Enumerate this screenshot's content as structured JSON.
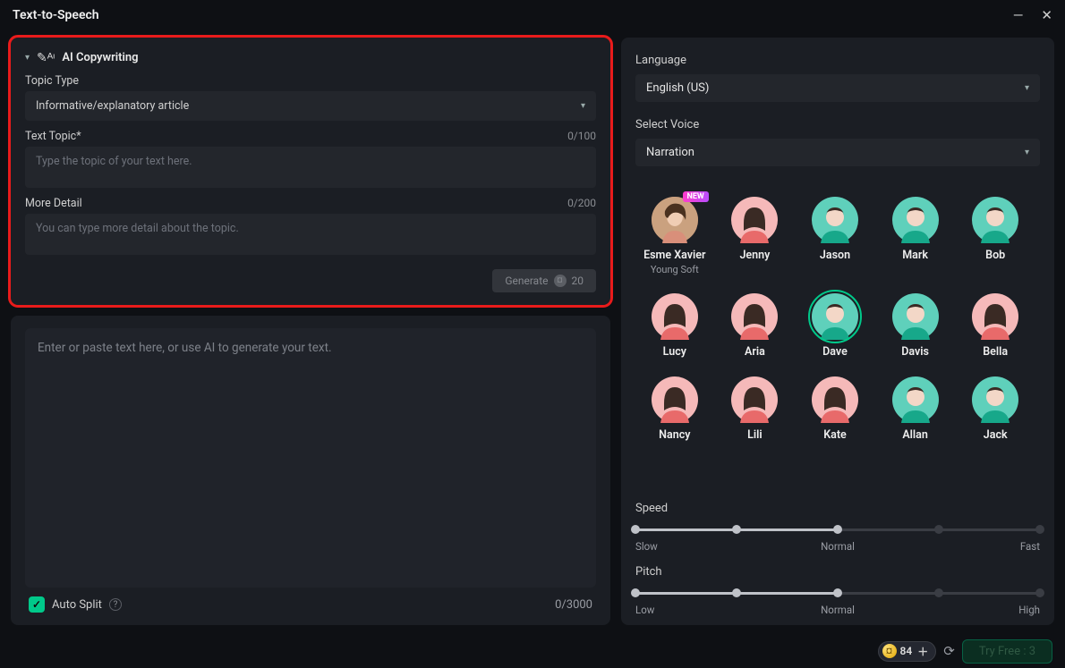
{
  "window": {
    "title": "Text-to-Speech"
  },
  "ai": {
    "heading": "AI Copywriting",
    "topic_type_label": "Topic Type",
    "topic_type_value": "Informative/explanatory article",
    "text_topic_label": "Text Topic*",
    "text_topic_counter": "0/100",
    "text_topic_placeholder": "Type the topic of your text here.",
    "more_detail_label": "More Detail",
    "more_detail_counter": "0/200",
    "more_detail_placeholder": "You can type more detail about the topic.",
    "generate_label": "Generate",
    "generate_cost": "20"
  },
  "editor": {
    "placeholder": "Enter or paste text here, or use AI to generate your text.",
    "autosplit_label": "Auto Split",
    "counter": "0/3000"
  },
  "side": {
    "language_label": "Language",
    "language_value": "English (US)",
    "voice_label": "Select Voice",
    "voice_value": "Narration"
  },
  "voices": [
    {
      "name": "Esme Xavier",
      "sub": "Young Soft",
      "photo": true,
      "badge": "NEW"
    },
    {
      "name": "Jenny",
      "g": "f",
      "col": "pink"
    },
    {
      "name": "Jason",
      "g": "m",
      "col": "teal"
    },
    {
      "name": "Mark",
      "g": "m",
      "col": "teal"
    },
    {
      "name": "Bob",
      "g": "m",
      "col": "teal"
    },
    {
      "name": "Lucy",
      "g": "f",
      "col": "pink"
    },
    {
      "name": "Aria",
      "g": "f",
      "col": "pink"
    },
    {
      "name": "Dave",
      "g": "m",
      "col": "teal",
      "selected": true
    },
    {
      "name": "Davis",
      "g": "m",
      "col": "teal"
    },
    {
      "name": "Bella",
      "g": "f",
      "col": "pink"
    },
    {
      "name": "Nancy",
      "g": "f",
      "col": "pink"
    },
    {
      "name": "Lili",
      "g": "f",
      "col": "pink"
    },
    {
      "name": "Kate",
      "g": "f",
      "col": "pink"
    },
    {
      "name": "Allan",
      "g": "m",
      "col": "teal"
    },
    {
      "name": "Jack",
      "g": "m",
      "col": "teal"
    }
  ],
  "sliders": {
    "speed": {
      "title": "Speed",
      "low": "Slow",
      "mid": "Normal",
      "high": "Fast",
      "value_pct": 50
    },
    "pitch": {
      "title": "Pitch",
      "low": "Low",
      "mid": "Normal",
      "high": "High",
      "value_pct": 50
    }
  },
  "bottom": {
    "credits": "84",
    "try_label": "Try Free : 3"
  }
}
